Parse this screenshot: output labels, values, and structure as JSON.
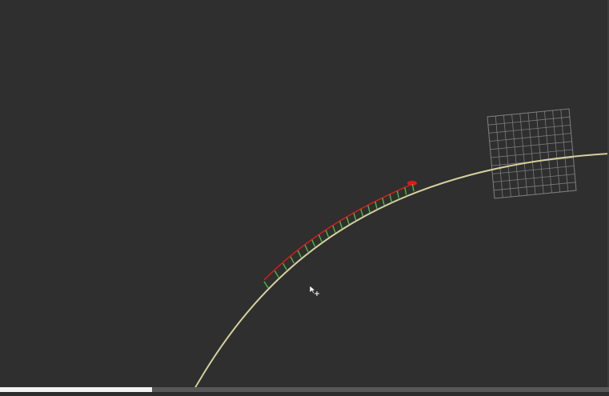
{
  "viewport": {
    "background": "#2f2f2f",
    "grid_color": "#8a8a8a",
    "curve_color": "#d6cf9c",
    "tick_color": "#3fbf3a",
    "marker_color": "#e21818"
  },
  "timeline": {
    "progress": 0.25,
    "fill_color": "#f2f2f2",
    "track_color": "#575757"
  },
  "cursor": {
    "icon": "move-cursor-icon"
  }
}
